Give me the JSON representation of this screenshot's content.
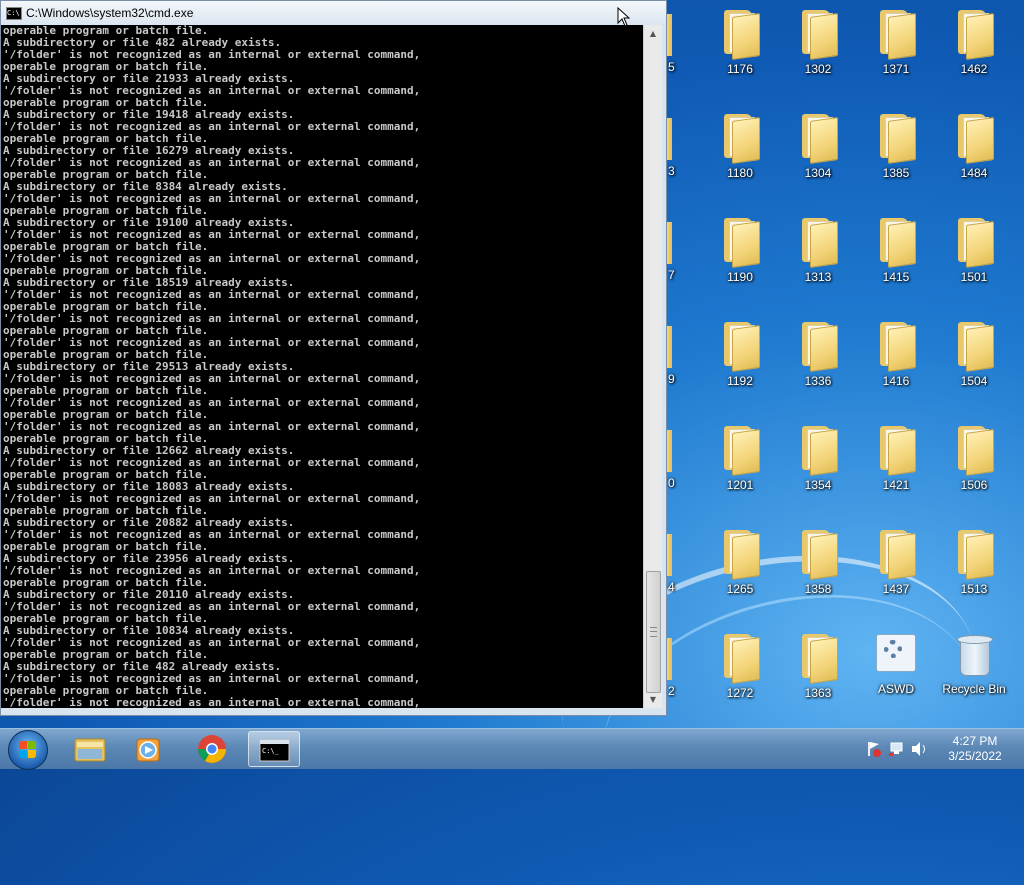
{
  "cmd": {
    "title": "C:\\Windows\\system32\\cmd.exe",
    "lines": [
      "operable program or batch file.",
      "A subdirectory or file 482 already exists.",
      "'/folder' is not recognized as an internal or external command,",
      "operable program or batch file.",
      "A subdirectory or file 21933 already exists.",
      "'/folder' is not recognized as an internal or external command,",
      "operable program or batch file.",
      "A subdirectory or file 19418 already exists.",
      "'/folder' is not recognized as an internal or external command,",
      "operable program or batch file.",
      "A subdirectory or file 16279 already exists.",
      "'/folder' is not recognized as an internal or external command,",
      "operable program or batch file.",
      "A subdirectory or file 8384 already exists.",
      "'/folder' is not recognized as an internal or external command,",
      "operable program or batch file.",
      "A subdirectory or file 19100 already exists.",
      "'/folder' is not recognized as an internal or external command,",
      "operable program or batch file.",
      "'/folder' is not recognized as an internal or external command,",
      "operable program or batch file.",
      "A subdirectory or file 18519 already exists.",
      "'/folder' is not recognized as an internal or external command,",
      "operable program or batch file.",
      "'/folder' is not recognized as an internal or external command,",
      "operable program or batch file.",
      "'/folder' is not recognized as an internal or external command,",
      "operable program or batch file.",
      "A subdirectory or file 29513 already exists.",
      "'/folder' is not recognized as an internal or external command,",
      "operable program or batch file.",
      "'/folder' is not recognized as an internal or external command,",
      "operable program or batch file.",
      "'/folder' is not recognized as an internal or external command,",
      "operable program or batch file.",
      "A subdirectory or file 12662 already exists.",
      "'/folder' is not recognized as an internal or external command,",
      "operable program or batch file.",
      "A subdirectory or file 18083 already exists.",
      "'/folder' is not recognized as an internal or external command,",
      "operable program or batch file.",
      "A subdirectory or file 20882 already exists.",
      "'/folder' is not recognized as an internal or external command,",
      "operable program or batch file.",
      "A subdirectory or file 23956 already exists.",
      "'/folder' is not recognized as an internal or external command,",
      "operable program or batch file.",
      "A subdirectory or file 20110 already exists.",
      "'/folder' is not recognized as an internal or external command,",
      "operable program or batch file.",
      "A subdirectory or file 10834 already exists.",
      "'/folder' is not recognized as an internal or external command,",
      "operable program or batch file.",
      "A subdirectory or file 482 already exists.",
      "'/folder' is not recognized as an internal or external command,",
      "operable program or batch file.",
      "'/folder' is not recognized as an internal or external command,"
    ],
    "scroll_position_fraction": 0.93
  },
  "desktop": {
    "partial_labels": [
      "5",
      "3",
      "7",
      "9",
      "0",
      "4",
      "2"
    ],
    "folders_col1": [
      "1176",
      "1180",
      "1190",
      "1192",
      "1201",
      "1265",
      "1272"
    ],
    "folders_col2": [
      "1302",
      "1304",
      "1313",
      "1336",
      "1354",
      "1358",
      "1363"
    ],
    "folders_col3": [
      "1371",
      "1385",
      "1415",
      "1416",
      "1421",
      "1437"
    ],
    "folders_col4": [
      "1462",
      "1484",
      "1501",
      "1504",
      "1506",
      "1513"
    ],
    "aswd_label": "ASWD",
    "recycle_label": "Recycle Bin"
  },
  "taskbar": {
    "items": [
      "start-button",
      "windows-explorer",
      "media-player",
      "google-chrome",
      "command-prompt"
    ],
    "time": "4:27 PM",
    "date": "3/25/2022",
    "colors": {
      "taskbar": "#5c88b6",
      "console_bg": "#000000",
      "console_text": "#c8c8c8"
    }
  }
}
